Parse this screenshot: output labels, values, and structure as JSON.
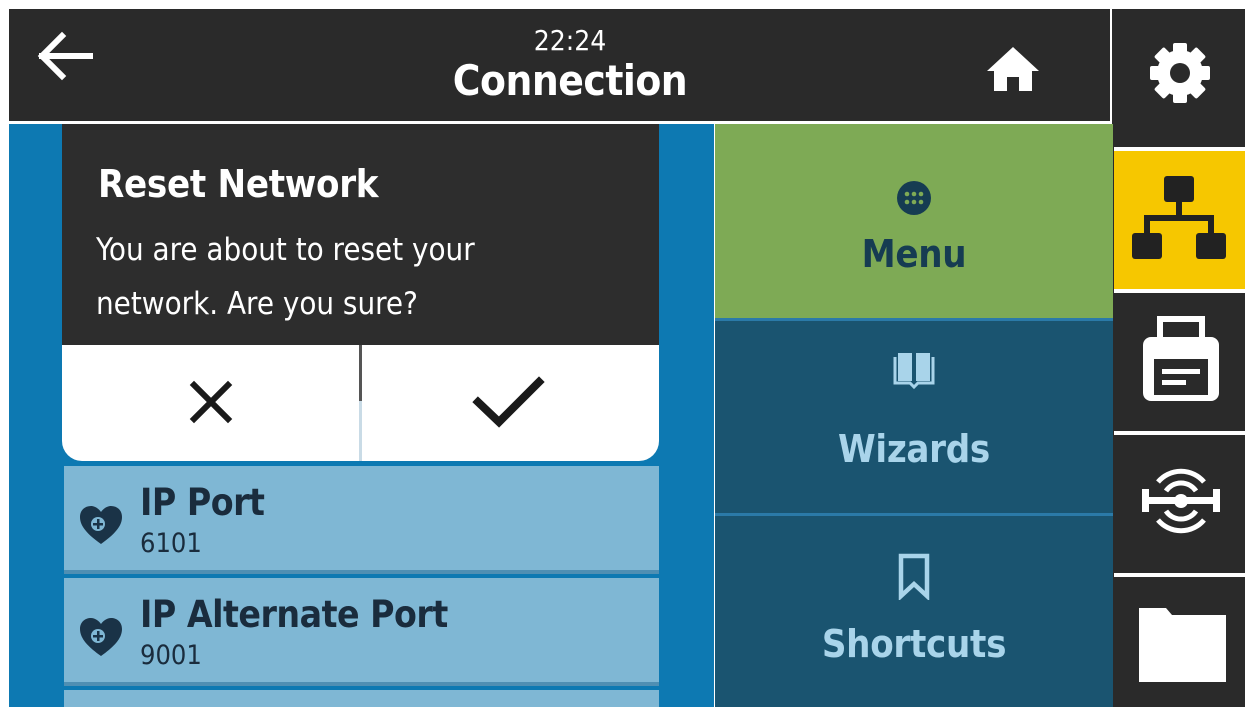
{
  "header": {
    "time": "22:24",
    "title": "Connection"
  },
  "dialog": {
    "title": "Reset Network",
    "message_line1": "You are about to reset your",
    "message_line2": "network. Are you sure?"
  },
  "list": [
    {
      "name": "IP Port",
      "value": "6101"
    },
    {
      "name": "IP Alternate Port",
      "value": "9001"
    }
  ],
  "menu_panel": [
    {
      "label": "Menu",
      "icon": "menu-grid-icon"
    },
    {
      "label": "Wizards",
      "icon": "book-icon"
    },
    {
      "label": "Shortcuts",
      "icon": "bookmark-icon"
    }
  ],
  "rail_icons": [
    "gear-icon",
    "network-icon",
    "printer-icon",
    "rfid-icon",
    "folder-icon"
  ],
  "colors": {
    "dark": "#2a2a2a",
    "accent_yellow": "#f6c700",
    "list_blue": "#0d79b2",
    "row_blue": "#7fb7d4",
    "menu_green": "#7eaa55",
    "panel_teal": "#1a5470",
    "label_text": "#a9d4ea"
  }
}
